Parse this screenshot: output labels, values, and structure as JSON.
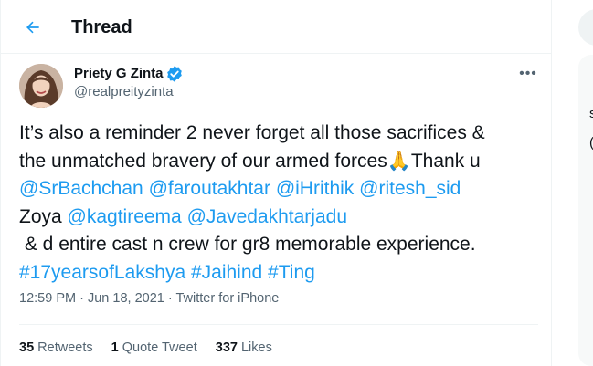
{
  "header": {
    "title": "Thread"
  },
  "tweet": {
    "display_name": "Priety G Zinta",
    "handle": "@realpreityzinta",
    "lines": [
      [
        {
          "t": "It’s also a reminder 2 never forget all those sacrifices &",
          "link": false
        }
      ],
      [
        {
          "t": "the unmatched bravery of our armed forces",
          "link": false
        },
        {
          "t": "🙏",
          "link": false
        },
        {
          "t": "Thank u",
          "link": false
        }
      ],
      [
        {
          "t": "@SrBachchan",
          "link": true
        },
        {
          "t": " ",
          "link": false
        },
        {
          "t": "@faroutakhtar",
          "link": true
        },
        {
          "t": " ",
          "link": false
        },
        {
          "t": "@iHrithik",
          "link": true
        },
        {
          "t": " ",
          "link": false
        },
        {
          "t": "@ritesh_sid",
          "link": true
        }
      ],
      [
        {
          "t": "Zoya ",
          "link": false
        },
        {
          "t": "@kagtireema",
          "link": true
        },
        {
          "t": " ",
          "link": false
        },
        {
          "t": "@Javedakhtarjadu",
          "link": true
        }
      ],
      [
        {
          "t": " & d entire cast n crew for gr8 memorable experience.",
          "link": false
        }
      ],
      [
        {
          "t": "#17yearsofLakshya",
          "link": true
        },
        {
          "t": " ",
          "link": false
        },
        {
          "t": "#Jaihind",
          "link": true
        },
        {
          "t": " ",
          "link": false
        },
        {
          "t": "#Ting",
          "link": true
        }
      ]
    ],
    "time": "12:59 PM",
    "dot": "·",
    "date": "Jun 18, 2021",
    "source": "Twitter for iPhone",
    "stats": [
      {
        "count": "35",
        "label": "Retweets"
      },
      {
        "count": "1",
        "label": "Quote Tweet"
      },
      {
        "count": "337",
        "label": "Likes"
      }
    ]
  },
  "right": {
    "fragments": [
      "s",
      "("
    ]
  },
  "colors": {
    "accent": "#1d9bf0",
    "text": "#0f1419",
    "muted": "#536471",
    "border": "#eff3f4"
  }
}
